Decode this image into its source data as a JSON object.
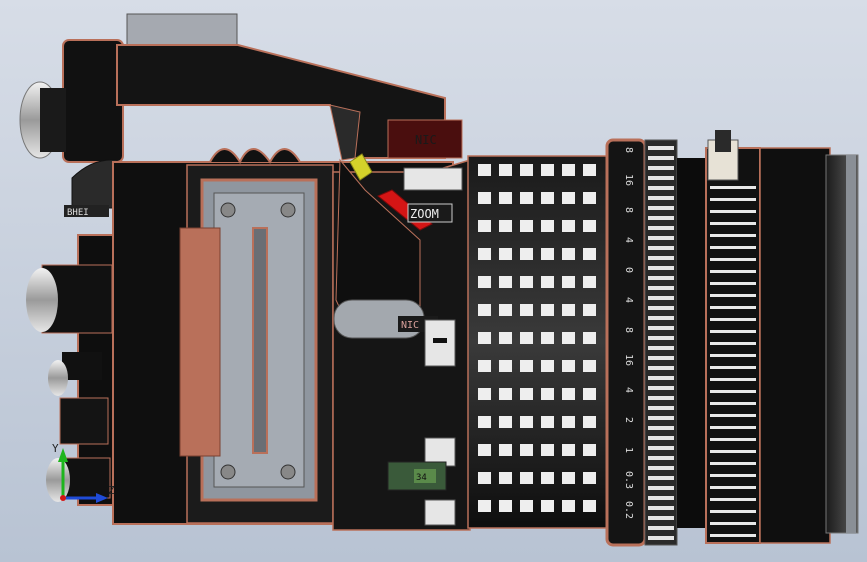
{
  "labels": {
    "zoom": "ZOOM",
    "mode": "NIC",
    "left_tag": "BHEI",
    "red_tag": "NIC",
    "green_tag": "34"
  },
  "focus_scale": [
    "8",
    "16",
    "8",
    "4",
    "0",
    "4",
    "8",
    "16",
    "4",
    "2",
    "1",
    "0.3",
    "0.2"
  ],
  "axis": {
    "x": "Z",
    "y": "Y"
  },
  "colors": {
    "copper": "#b9705a",
    "body": "#121212",
    "metal": "#9aa0a8",
    "background": "#c7d0dd"
  }
}
